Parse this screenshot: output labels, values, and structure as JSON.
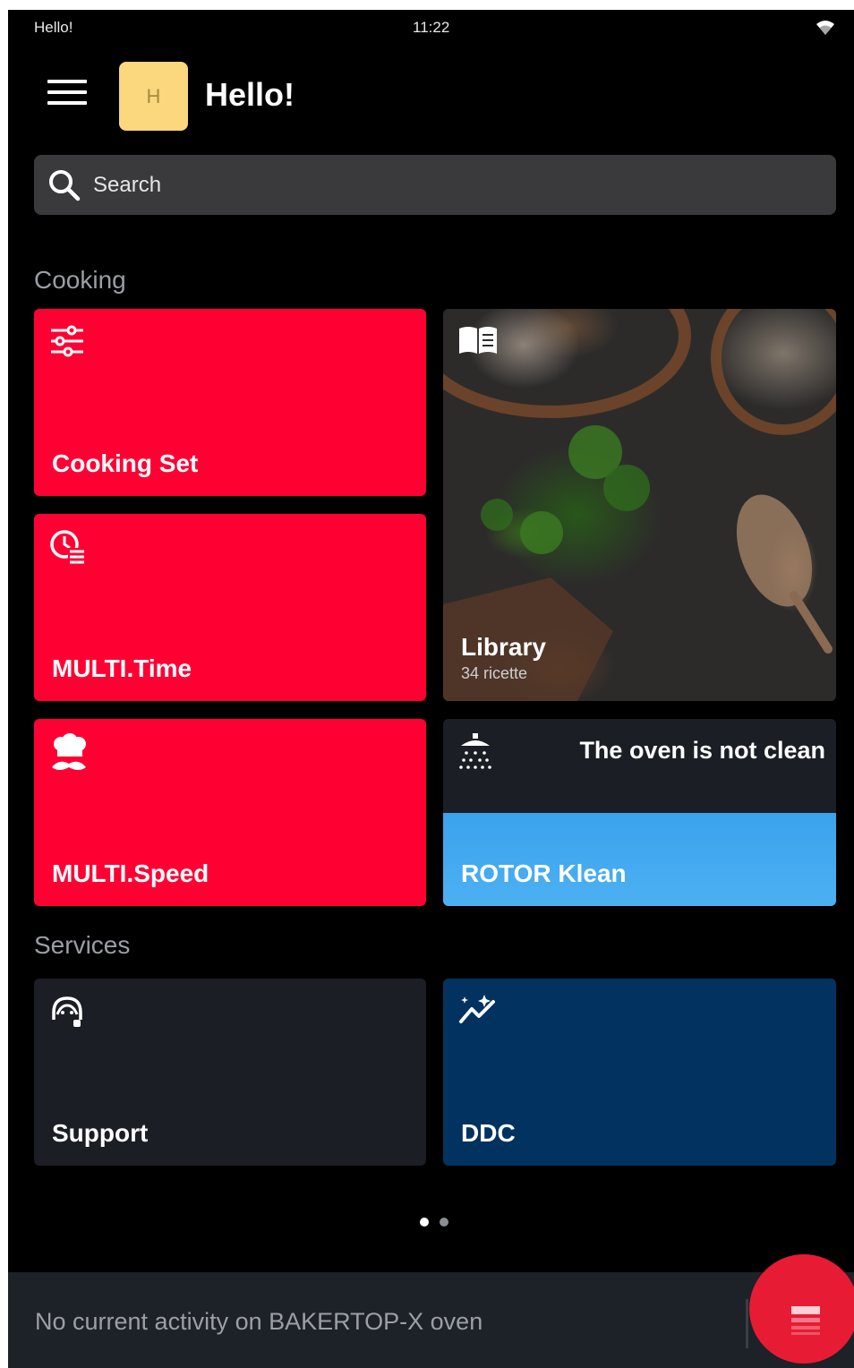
{
  "status_bar": {
    "title": "Hello!",
    "time": "11:22"
  },
  "header": {
    "avatar_initial": "H",
    "title": "Hello!"
  },
  "search": {
    "placeholder": "Search"
  },
  "cooking": {
    "section_label": "Cooking",
    "cooking_set": "Cooking Set",
    "multi_time": "MULTI.Time",
    "multi_speed": "MULTI.Speed",
    "library": {
      "label": "Library",
      "count": "34 ricette"
    },
    "rotor_klean": {
      "message": "The oven is not clean",
      "label": "ROTOR Klean"
    }
  },
  "services": {
    "section_label": "Services",
    "support": "Support",
    "ddc": "DDC"
  },
  "pager": {
    "pages": 2,
    "active": 1
  },
  "bottom": {
    "activity_text": "No current activity on BAKERTOP-X oven"
  },
  "colors": {
    "accent_red": "#ff0033",
    "tile_dark": "#1b1e24",
    "ddc_navy": "#023260",
    "rotor_blue": "#44aaf0",
    "avatar": "#fbd77d"
  }
}
